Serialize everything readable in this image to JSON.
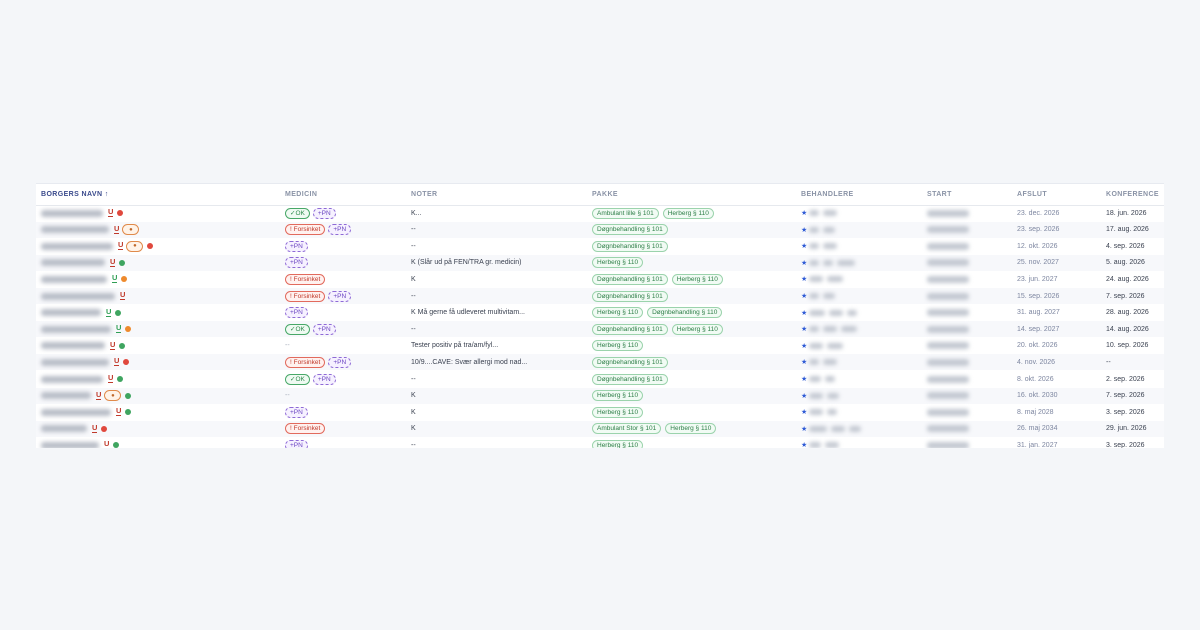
{
  "columns": [
    {
      "key": "name",
      "label": "BORGERS NAVN ↑"
    },
    {
      "key": "medicin",
      "label": "MEDICIN"
    },
    {
      "key": "noter",
      "label": "NOTER"
    },
    {
      "key": "pakke",
      "label": "PAKKE"
    },
    {
      "key": "behandlere",
      "label": "BEHANDLERE"
    },
    {
      "key": "start",
      "label": "START"
    },
    {
      "key": "afslut",
      "label": "AFSLUT"
    },
    {
      "key": "konference",
      "label": "KONFERENCE"
    }
  ],
  "colors": {
    "ok": "#2e8a4c",
    "late": "#c0392b",
    "pn": "#6b45c2",
    "status_red": "#e0483d",
    "status_green": "#3fa560",
    "status_orange": "#ee8a2d"
  },
  "rows": [
    {
      "u": "red",
      "bag": false,
      "dot": "red",
      "medicin": [
        {
          "type": "ok",
          "label": "✓OK"
        },
        {
          "type": "pn",
          "label": "+PN"
        }
      ],
      "note": "K...",
      "pakke": [
        "Ambulant lille § 101",
        "Herberg § 110"
      ],
      "afslut": "23. dec. 2026",
      "konference": "18. jun. 2026"
    },
    {
      "u": "red",
      "bag": true,
      "dot": null,
      "medicin": [
        {
          "type": "late",
          "label": "! Forsinket"
        },
        {
          "type": "pn",
          "label": "+PN"
        }
      ],
      "note": "--",
      "pakke": [
        "Døgnbehandling § 101"
      ],
      "afslut": "23. sep. 2026",
      "konference": "17. aug. 2026"
    },
    {
      "u": "red",
      "bag": true,
      "dot": "red",
      "medicin": [
        {
          "type": "pn",
          "label": "+PN"
        }
      ],
      "note": "--",
      "pakke": [
        "Døgnbehandling § 101"
      ],
      "afslut": "12. okt. 2026",
      "konference": "4. sep. 2026"
    },
    {
      "u": "red",
      "bag": false,
      "dot": "green",
      "medicin": [
        {
          "type": "pn",
          "label": "+PN"
        }
      ],
      "note": "K (Slår ud på FEN/TRA gr. medicin)",
      "pakke": [
        "Herberg § 110"
      ],
      "afslut": "25. nov. 2027",
      "konference": "5. aug. 2026"
    },
    {
      "u": "green",
      "bag": false,
      "dot": "orange",
      "medicin": [
        {
          "type": "late",
          "label": "! Forsinket"
        }
      ],
      "note": "K",
      "pakke": [
        "Døgnbehandling § 101",
        "Herberg § 110"
      ],
      "afslut": "23. jun. 2027",
      "konference": "24. aug. 2026"
    },
    {
      "u": "red",
      "bag": false,
      "dot": null,
      "medicin": [
        {
          "type": "late",
          "label": "! Forsinket"
        },
        {
          "type": "pn",
          "label": "+PN"
        }
      ],
      "note": "--",
      "pakke": [
        "Døgnbehandling § 101"
      ],
      "afslut": "15. sep. 2026",
      "konference": "7. sep. 2026"
    },
    {
      "u": "green",
      "bag": false,
      "dot": "green",
      "medicin": [
        {
          "type": "pn",
          "label": "+PN"
        }
      ],
      "note": "K Må gerne få udleveret multivitam...",
      "pakke": [
        "Herberg § 110",
        "Døgnbehandling § 110"
      ],
      "afslut": "31. aug. 2027",
      "konference": "28. aug. 2026"
    },
    {
      "u": "green",
      "bag": false,
      "dot": "orange",
      "medicin": [
        {
          "type": "ok",
          "label": "✓OK"
        },
        {
          "type": "pn",
          "label": "+PN"
        }
      ],
      "note": "--",
      "pakke": [
        "Døgnbehandling § 101",
        "Herberg § 110"
      ],
      "afslut": "14. sep. 2027",
      "konference": "14. aug. 2026"
    },
    {
      "u": "red",
      "bag": false,
      "dot": "green",
      "medicin": [],
      "note": "Tester positiv på tra/am/fyl...",
      "pakke": [
        "Herberg § 110"
      ],
      "afslut": "20. okt. 2026",
      "konference": "10. sep. 2026"
    },
    {
      "u": "red",
      "bag": false,
      "dot": "red",
      "medicin": [
        {
          "type": "late",
          "label": "! Forsinket"
        },
        {
          "type": "pn",
          "label": "+PN"
        }
      ],
      "note": "10/9....CAVE: Svær allergi mod nad...",
      "pakke": [
        "Døgnbehandling § 101"
      ],
      "afslut": "4. nov. 2026",
      "konference": "--"
    },
    {
      "u": "red",
      "bag": false,
      "dot": "green",
      "medicin": [
        {
          "type": "ok",
          "label": "✓OK"
        },
        {
          "type": "pn",
          "label": "+PN"
        }
      ],
      "note": "--",
      "pakke": [
        "Døgnbehandling § 101"
      ],
      "afslut": "8. okt. 2026",
      "konference": "2. sep. 2026"
    },
    {
      "u": "red",
      "bag": true,
      "dot": "green",
      "medicin": [],
      "note": "K",
      "pakke": [
        "Herberg § 110"
      ],
      "afslut": "16. okt. 2030",
      "konference": "7. sep. 2026"
    },
    {
      "u": "red",
      "bag": false,
      "dot": "green",
      "medicin": [
        {
          "type": "pn",
          "label": "+PN"
        }
      ],
      "note": "K",
      "pakke": [
        "Herberg § 110"
      ],
      "afslut": "8. maj 2028",
      "konference": "3. sep. 2026"
    },
    {
      "u": "red",
      "bag": false,
      "dot": "red",
      "medicin": [
        {
          "type": "late",
          "label": "! Forsinket"
        }
      ],
      "note": "K",
      "pakke": [
        "Ambulant Stor § 101",
        "Herberg § 110"
      ],
      "afslut": "26. maj 2034",
      "konference": "29. jun. 2026"
    },
    {
      "u": "red",
      "bag": false,
      "dot": "green",
      "medicin": [
        {
          "type": "pn",
          "label": "+PN"
        }
      ],
      "note": "--",
      "pakke": [
        "Herberg § 110"
      ],
      "afslut": "31. jan. 2027",
      "konference": "3. sep. 2026"
    }
  ]
}
